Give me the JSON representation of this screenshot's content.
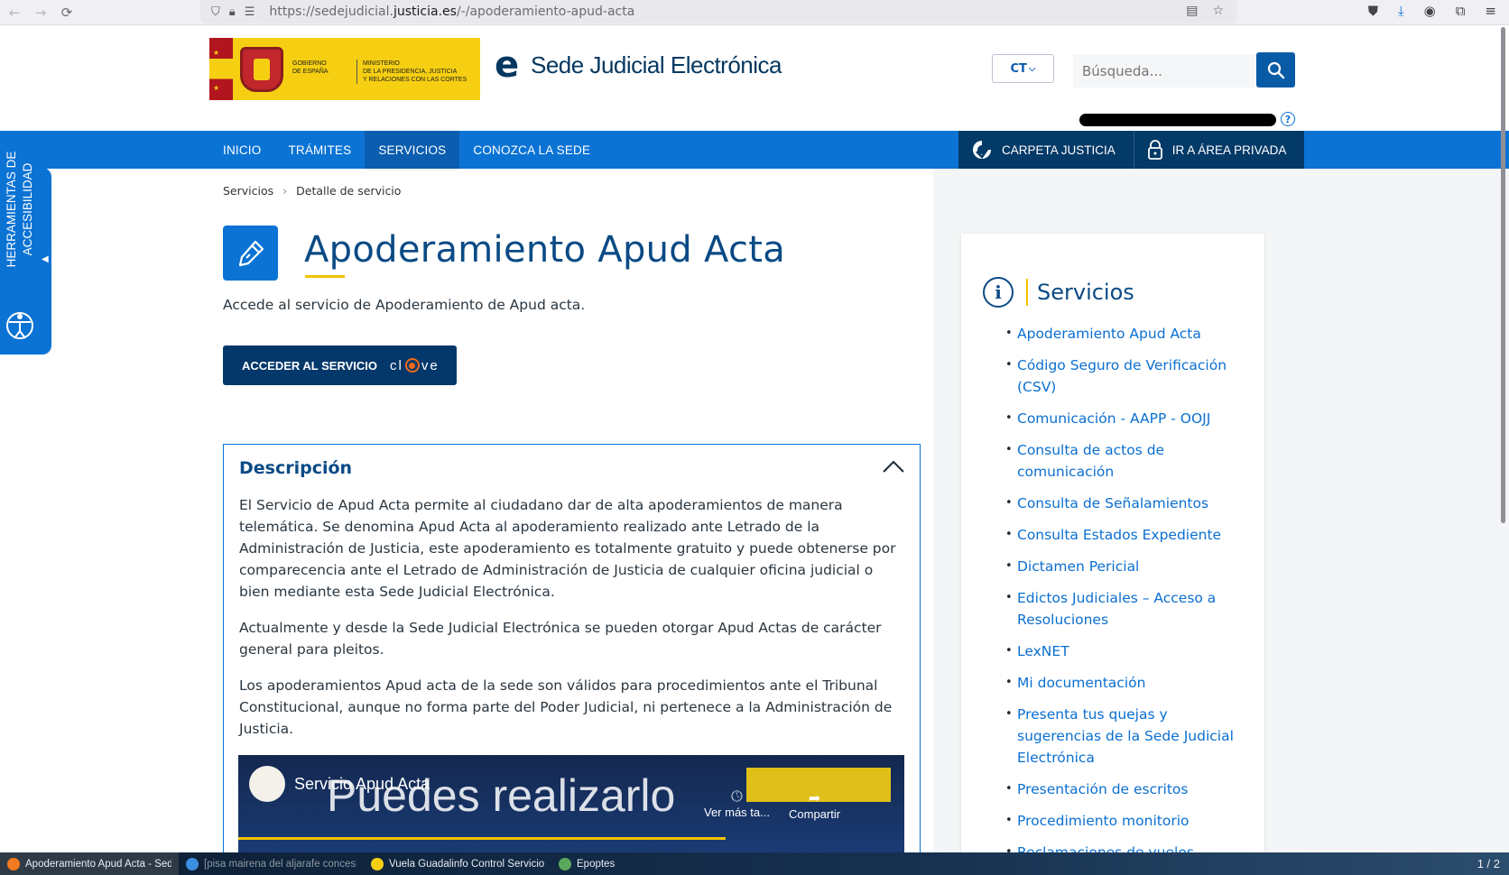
{
  "browser": {
    "url_prefix": "https://sedejudicial.",
    "url_domain": "justicia.es",
    "url_path": "/-/apoderamiento-apud-acta"
  },
  "header": {
    "gov_line1": "GOBIERNO",
    "gov_line2": "DE ESPAÑA",
    "ministry_line1": "MINISTERIO",
    "ministry_line2": "DE LA PRESIDENCIA, JUSTICIA",
    "ministry_line3": "Y RELACIONES CON LAS CORTES",
    "site_name": "Sede Judicial Electrónica",
    "language": "CT",
    "search_placeholder": "Búsqueda..."
  },
  "nav": {
    "items": [
      {
        "label": "INICIO",
        "active": false
      },
      {
        "label": "TRÁMITES",
        "active": false
      },
      {
        "label": "SERVICIOS",
        "active": true
      },
      {
        "label": "CONOZCA LA SEDE",
        "active": false
      }
    ],
    "carpeta": "CARPETA JUSTICIA",
    "private_area": "IR A ÁREA PRIVADA"
  },
  "accessibility": {
    "label_line1": "HERRAMIENTAS DE",
    "label_line2": "ACCESIBILIDAD"
  },
  "breadcrumb": {
    "items": [
      "Servicios",
      "Detalle de servicio"
    ]
  },
  "main": {
    "title": "Apoderamiento Apud Acta",
    "subtitle": "Accede al servicio de Apoderamiento de Apud acta.",
    "access_button": "ACCEDER AL SERVICIO",
    "clave_c": "cl",
    "clave_ve": "ve",
    "description": {
      "title": "Descripción",
      "paragraphs": [
        "El Servicio de Apud Acta permite al ciudadano dar de alta apoderamientos de manera telemática. Se denomina Apud Acta al apoderamiento realizado ante Letrado de la Administración de Justicia, este apoderamiento es totalmente gratuito y puede obtenerse por comparecencia ante el Letrado de Administración de Justicia de cualquier oficina judicial o bien mediante esta Sede Judicial Electrónica.",
        "Actualmente y desde la Sede Judicial Electrónica se pueden otorgar Apud Actas de carácter general para pleitos.",
        "Los apoderamientos Apud acta de la sede son válidos para procedimientos ante el Tribunal Constitucional, aunque no forma parte del Poder Judicial, ni pertenece a la Administración de Justicia."
      ]
    },
    "video": {
      "title": "Servicio Apud Acta",
      "overlay_text": "Puedes realizarlo",
      "watch_later": "Ver más ta...",
      "share": "Compartir"
    }
  },
  "services_panel": {
    "title": "Servicios",
    "items": [
      "Apoderamiento Apud Acta",
      "Código Seguro de Verificación (CSV)",
      "Comunicación - AAPP - OOJJ",
      "Consulta de actos de comunicación",
      "Consulta de Señalamientos",
      "Consulta Estados Expediente",
      "Dictamen Pericial",
      "Edictos Judiciales – Acceso a Resoluciones",
      "LexNET",
      "Mi documentación",
      "Presenta tus quejas y sugerencias de la Sede Judicial Electrónica",
      "Presentación de escritos",
      "Procedimiento monitorio",
      "Reclamaciones de vuelos"
    ]
  },
  "taskbar": {
    "tasks": [
      {
        "label": "Apoderamiento Apud Acta - Sede ...",
        "color": "#f47a1f"
      },
      {
        "label": "[pisa mairena del aljarafe concesi...",
        "color": "#3b8ee0"
      },
      {
        "label": "Vuela Guadalinfo Control Servicios",
        "color": "#f6cf13"
      },
      {
        "label": "Epoptes",
        "color": "#5aa85a"
      }
    ],
    "page_indicator": "1 / 2"
  },
  "colors": {
    "primary": "#0b73d4",
    "dark": "#04386a",
    "accent": "#f2c300"
  }
}
